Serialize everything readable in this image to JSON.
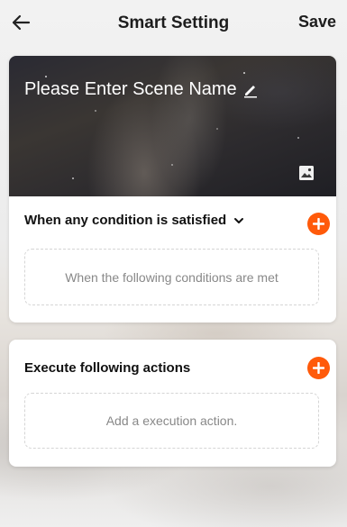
{
  "header": {
    "back_icon": "arrow-left-icon",
    "title": "Smart Setting",
    "save_label": "Save"
  },
  "scene": {
    "name_placeholder": "Please Enter Scene Name",
    "edit_icon": "pencil-icon",
    "image_icon": "image-icon"
  },
  "conditions": {
    "title": "When any condition is satisfied",
    "dropdown_icon": "chevron-down-icon",
    "add_icon": "plus-icon",
    "empty_text": "When the following conditions are met"
  },
  "actions": {
    "title": "Execute following actions",
    "add_icon": "plus-icon",
    "empty_text": "Add a execution action."
  },
  "colors": {
    "accent": "#ff5a0a",
    "text_primary": "#1d1d1d",
    "placeholder_text": "#888888"
  }
}
